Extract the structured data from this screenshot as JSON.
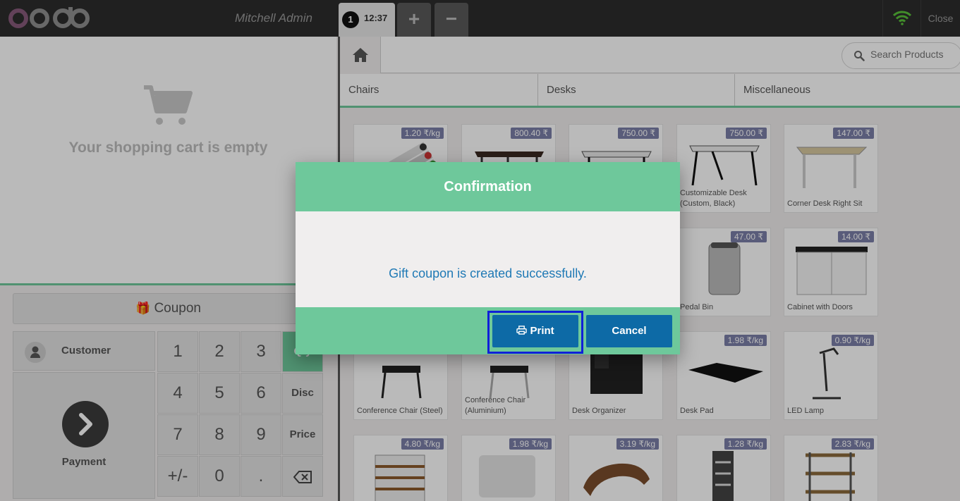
{
  "topbar": {
    "logo_text": "odoo",
    "cashier": "Mitchell Admin",
    "order": {
      "number": "1",
      "time": "12:37"
    },
    "add_label": "+",
    "remove_label": "−",
    "close_label": "Close"
  },
  "cart": {
    "empty_message": "Your shopping cart is empty"
  },
  "actions": {
    "coupon_label": "Coupon",
    "customer_label": "Customer",
    "payment_label": "Payment"
  },
  "numpad": {
    "keys": [
      "1",
      "2",
      "3",
      "4",
      "5",
      "6",
      "7",
      "8",
      "9",
      "+/-",
      "0",
      "."
    ],
    "modes": [
      "Qty",
      "Disc",
      "Price"
    ]
  },
  "search": {
    "placeholder": "Search Products"
  },
  "categories": [
    "Chairs",
    "Desks",
    "Miscellaneous"
  ],
  "products": [
    {
      "name": "",
      "price": "1.20 ₹/kg"
    },
    {
      "name": "",
      "price": "800.40 ₹"
    },
    {
      "name": "",
      "price": "750.00 ₹"
    },
    {
      "name": "Customizable Desk (Custom, Black)",
      "price": "750.00 ₹"
    },
    {
      "name": "Corner Desk Right Sit",
      "price": "147.00 ₹"
    },
    {
      "name": "",
      "price": ""
    },
    {
      "name": "",
      "price": ""
    },
    {
      "name": "",
      "price": ""
    },
    {
      "name": "Pedal Bin",
      "price": "47.00 ₹"
    },
    {
      "name": "Cabinet with Doors",
      "price": "14.00 ₹"
    },
    {
      "name": "Conference Chair (Steel)",
      "price": ""
    },
    {
      "name": "Conference Chair (Aluminium)",
      "price": ""
    },
    {
      "name": "Desk Organizer",
      "price": ""
    },
    {
      "name": "Desk Pad",
      "price": "1.98 ₹/kg"
    },
    {
      "name": "LED Lamp",
      "price": "0.90 ₹/kg"
    },
    {
      "name": "",
      "price": "4.80 ₹/kg"
    },
    {
      "name": "",
      "price": "1.98 ₹/kg"
    },
    {
      "name": "",
      "price": "3.19 ₹/kg"
    },
    {
      "name": "",
      "price": "1.28 ₹/kg"
    },
    {
      "name": "",
      "price": "2.83 ₹/kg"
    }
  ],
  "modal": {
    "title": "Confirmation",
    "message": "Gift coupon is created successfully.",
    "print_label": "Print",
    "cancel_label": "Cancel"
  },
  "colors": {
    "accent": "#6ec89b",
    "button": "#0d6aa6",
    "highlight": "#1020d8",
    "price_badge": "#7b7fa8"
  }
}
